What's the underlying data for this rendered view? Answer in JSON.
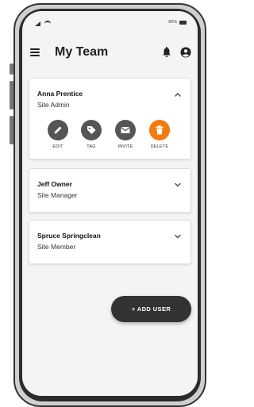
{
  "status_bar": {
    "battery_text": "80%"
  },
  "app_bar": {
    "title": "My Team",
    "menu_icon": "menu-icon",
    "notifications_icon": "bell-icon",
    "account_icon": "account-circle-icon"
  },
  "members": [
    {
      "name": "Anna Prentice",
      "role": "Site Admin",
      "expanded": true,
      "actions": [
        {
          "label": "EDIT",
          "icon": "pencil-icon"
        },
        {
          "label": "TAG",
          "icon": "tag-icon"
        },
        {
          "label": "INVITE",
          "icon": "mail-icon"
        },
        {
          "label": "DELETE",
          "icon": "trash-icon"
        }
      ]
    },
    {
      "name": "Jeff Owner",
      "role": "Site Manager",
      "expanded": false
    },
    {
      "name": "Spruce Springclean",
      "role": "Site Member",
      "expanded": false
    }
  ],
  "fab": {
    "label": "+ ADD USER"
  },
  "colors": {
    "action_default": "#555555",
    "action_delete": "#f47a0a",
    "fab_background": "#333333",
    "screen_background": "#f4f4f4"
  }
}
